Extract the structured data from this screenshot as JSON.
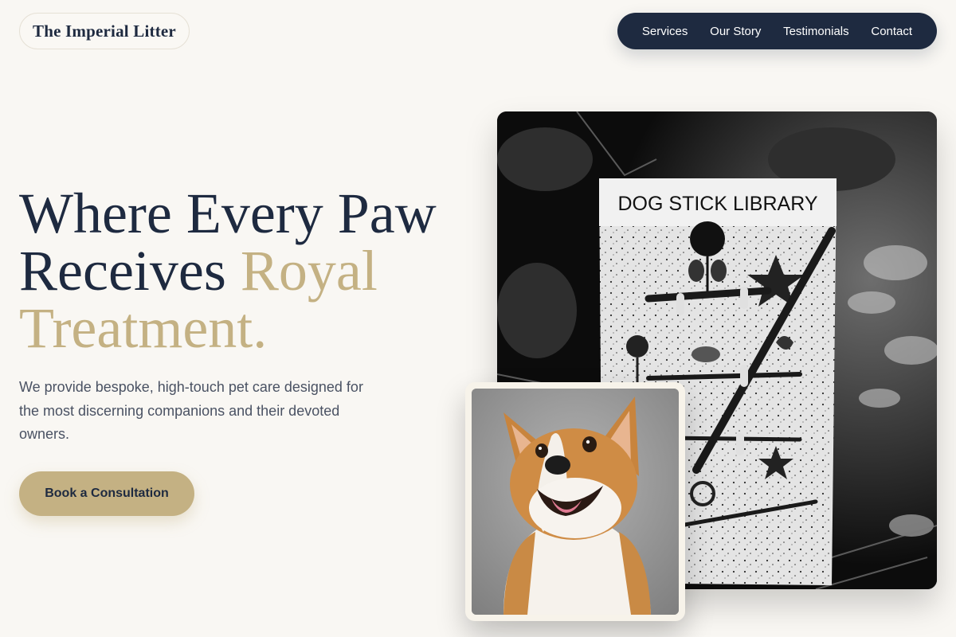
{
  "brand": {
    "name": "The Imperial Litter"
  },
  "nav": {
    "items": [
      {
        "label": "Services"
      },
      {
        "label": "Our Story"
      },
      {
        "label": "Testimonials"
      },
      {
        "label": "Contact"
      }
    ]
  },
  "hero": {
    "title_line1": "Where Every Paw",
    "title_line2_dark": "Receives ",
    "title_line2_gold": "Royal",
    "title_line3": "Treatment.",
    "description": "We provide bespoke, high-touch pet care designed for the most discerning companions and their devoted owners.",
    "cta_label": "Book a Consultation"
  },
  "images": {
    "main": {
      "sign_text": "DOG STICK LIBRARY",
      "subject": "dog-stick-library-photo"
    },
    "secondary": {
      "subject": "corgi-photo"
    }
  },
  "colors": {
    "navy": "#1e2a40",
    "gold": "#c4b183",
    "background": "#f9f7f3",
    "body_text": "#4a5263"
  }
}
